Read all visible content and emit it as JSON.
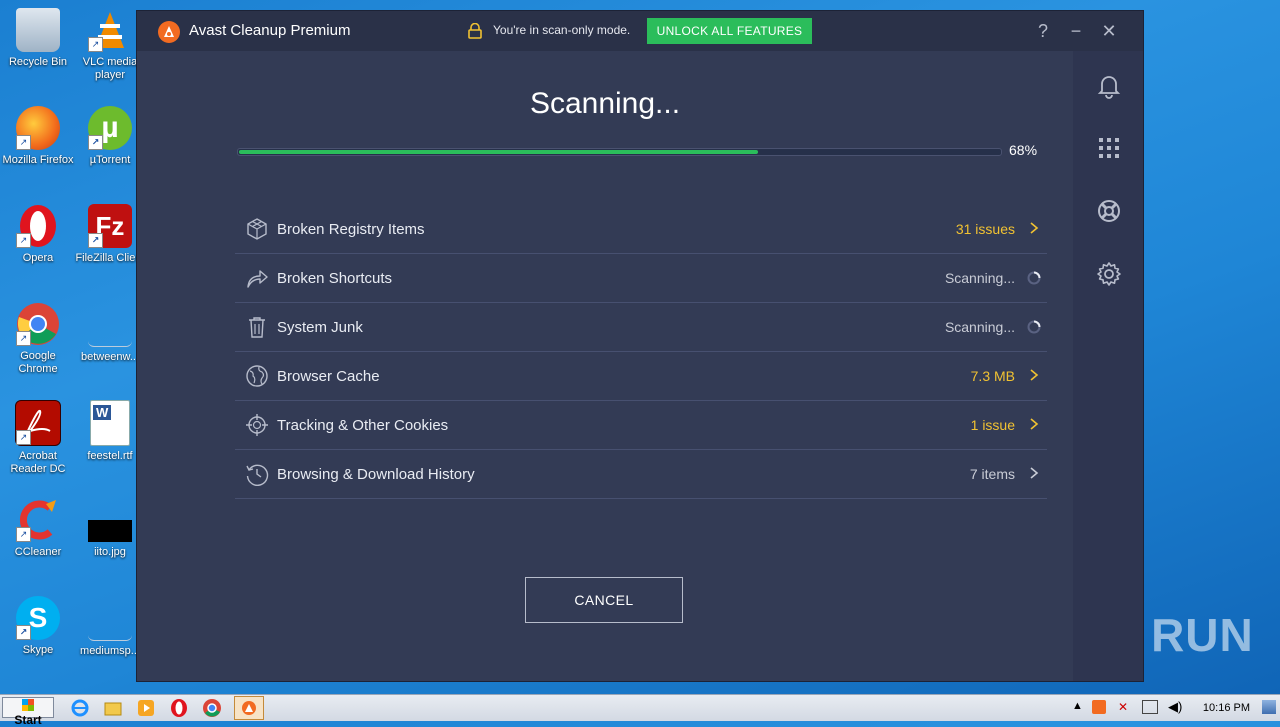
{
  "desktop": {
    "icons": [
      {
        "label": "Recycle Bin"
      },
      {
        "label": "VLC media player"
      },
      {
        "label": "Mozilla Firefox"
      },
      {
        "label": "µTorrent"
      },
      {
        "label": "Opera"
      },
      {
        "label": "FileZilla Client"
      },
      {
        "label": "Google Chrome"
      },
      {
        "label": "betweenw..."
      },
      {
        "label": "Acrobat Reader DC"
      },
      {
        "label": "feestel.rtf"
      },
      {
        "label": "CCleaner"
      },
      {
        "label": "iito.jpg"
      },
      {
        "label": "Skype"
      },
      {
        "label": "mediumsp..."
      }
    ]
  },
  "window": {
    "app_title": "Avast Cleanup Premium",
    "mode_notice": "You're in scan-only mode.",
    "unlock_label": "UNLOCK ALL FEATURES",
    "help_label": "?",
    "minimize_label": "−",
    "close_label": "✕"
  },
  "scan": {
    "heading": "Scanning...",
    "progress_percent": 68,
    "progress_text": "68%",
    "items": [
      {
        "label": "Broken Registry Items",
        "status": "31 issues",
        "state": "warn",
        "icon": "cube-icon"
      },
      {
        "label": "Broken Shortcuts",
        "status": "Scanning...",
        "state": "scanning",
        "icon": "shortcut-arrow-icon"
      },
      {
        "label": "System Junk",
        "status": "Scanning...",
        "state": "scanning",
        "icon": "trash-icon"
      },
      {
        "label": "Browser Cache",
        "status": "7.3 MB",
        "state": "warn",
        "icon": "globe-icon"
      },
      {
        "label": "Tracking & Other Cookies",
        "status": "1 issue",
        "state": "warn",
        "icon": "crosshair-icon"
      },
      {
        "label": "Browsing & Download History",
        "status": "7 items",
        "state": "normal",
        "icon": "history-clock-icon"
      }
    ],
    "cancel_label": "CANCEL"
  },
  "sidebar": {
    "icons": [
      "bell-icon",
      "apps-grid-icon",
      "lifebuoy-icon",
      "settings-gear-icon"
    ]
  },
  "taskbar": {
    "start_label": "Start",
    "clock": "10:16 PM"
  },
  "watermark": "ANY RUN",
  "colors": {
    "accent_green": "#2bbd5b",
    "warn_yellow": "#f1c232",
    "window_bg": "#333b55"
  }
}
